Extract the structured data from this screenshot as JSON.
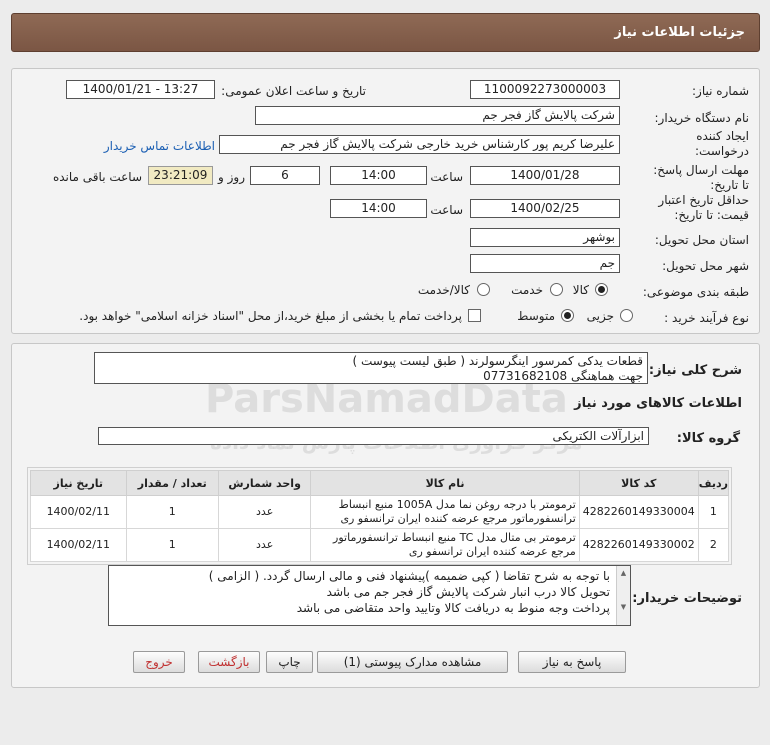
{
  "header": {
    "title": "جزئیات اطلاعات نیاز"
  },
  "form": {
    "need_number_label": "شماره نیاز:",
    "need_number": "1100092273000003",
    "announce_label": "تاریخ و ساعت اعلان عمومی:",
    "announce_value": "1400/01/21 - 13:27",
    "buyer_org_label": "نام دستگاه خریدار:",
    "buyer_org": "شرکت پالایش گاز فجر جم",
    "creator_label": "ایجاد کننده درخواست:",
    "creator": "علیرضا کریم پور کارشناس خرید خارجی شرکت پالایش گاز فجر جم",
    "contact_link": "اطلاعات تماس خریدار",
    "reply_deadline_label": "مهلت ارسال پاسخ: تا تاریخ:",
    "reply_date": "1400/01/28",
    "time_label": "ساعت",
    "reply_time": "14:00",
    "days_value": "6",
    "days_label": "روز و",
    "remaining_time": "23:21:09",
    "remaining_label": "ساعت باقی مانده",
    "validity_label": "حداقل تاریخ اعتبار قیمت: تا تاریخ:",
    "validity_date": "1400/02/25",
    "validity_time": "14:00",
    "province_label": "استان محل تحویل:",
    "province": "بوشهر",
    "city_label": "شهر محل تحویل:",
    "city": "جم",
    "category_label": "طبقه بندی موضوعی:",
    "category_options": [
      "کالا",
      "خدمت",
      "کالا/خدمت"
    ],
    "process_label": "نوع فرآیند خرید :",
    "process_options": [
      "جزیی",
      "متوسط"
    ],
    "payment_note": "پرداخت تمام یا بخشی از مبلغ خرید،از محل \"اسناد خزانه اسلامی\" خواهد بود."
  },
  "summary": {
    "label": "شرح کلی نیاز:",
    "line1": "قطعات یدکی کمرسور اینگرسولرند ( طبق لیست پیوست )",
    "line2": "جهت هماهنگی 07731682108"
  },
  "goods_section": {
    "title": "اطلاعات کالاهای مورد نیاز",
    "group_label": "گروه کالا:",
    "group_value": "ابزارآلات الکتریکی"
  },
  "table": {
    "headers": [
      "ردیف",
      "کد کالا",
      "نام کالا",
      "واحد شمارش",
      "تعداد / مقدار",
      "تاریخ نیاز"
    ],
    "rows": [
      {
        "index": "1",
        "code": "4282260149330004",
        "name": "ترمومتر با درجه روغن نما مدل 1005A منبع انبساط ترانسفورماتور مرجع عرضه کننده ایران ترانسفو ری",
        "unit": "عدد",
        "qty": "1",
        "date": "1400/02/11"
      },
      {
        "index": "2",
        "code": "4282260149330002",
        "name": "ترمومتر بی متال مدل TC منبع انبساط ترانسفورماتور مرجع عرضه کننده ایران ترانسفو ری",
        "unit": "عدد",
        "qty": "1",
        "date": "1400/02/11"
      }
    ]
  },
  "buyer_notes": {
    "label": "توضیحات خریدار:",
    "lines": [
      "با توجه به شرح تقاضا ( کپی ضمیمه )پیشنهاد فنی و مالی ارسال گردد. ( الزامی )",
      "تحویل کالا درب انبار شرکت  پالایش گاز فجر جم می باشد",
      "پرداخت وجه منوط به دریافت کالا وتایید واحد متقاضی می باشد"
    ]
  },
  "buttons": {
    "reply": "پاسخ به نیاز",
    "attachments": "مشاهده مدارک پیوستی (1)",
    "print": "چاپ",
    "back": "بازگشت",
    "exit": "خروج"
  },
  "watermark": {
    "brand": "ParsNamadData",
    "tagline": "مرکز فرآوری اطلاعات پارس نماد داده"
  },
  "colors": {
    "header": "#7b5644",
    "link": "#1b5fb3",
    "timer_bg": "#f1eac2"
  }
}
